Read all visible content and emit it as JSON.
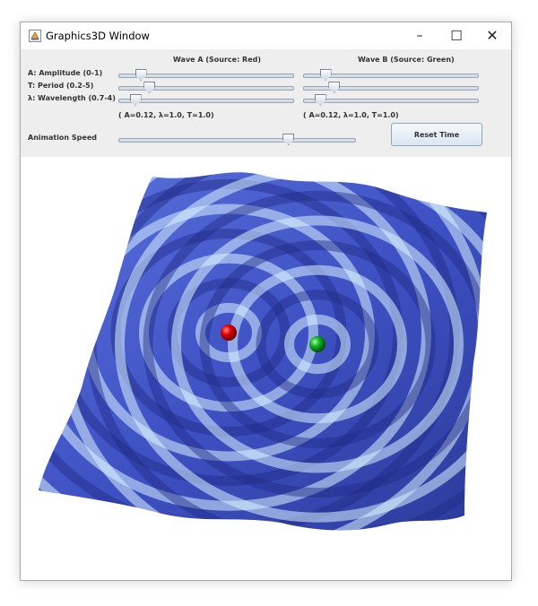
{
  "window": {
    "title": "Graphics3D Window",
    "buttons": {
      "minimize": "–",
      "maximize": "☐",
      "close": "✕"
    }
  },
  "panel": {
    "wave_a_header": "Wave A (Source: Red)",
    "wave_b_header": "Wave B (Source: Green)",
    "labels": {
      "amplitude": "A: Amplitude (0-1)",
      "period": "T: Period (0.2-5)",
      "wavelength": "λ: Wavelength (0.7-4)"
    },
    "wave_a": {
      "amplitude_level": 0.12,
      "period_level": 0.17,
      "wavelength_level": 0.09,
      "readout": "( A=0.12, λ=1.0, T=1.0)"
    },
    "wave_b": {
      "amplitude_level": 0.12,
      "period_level": 0.17,
      "wavelength_level": 0.09,
      "readout": "( A=0.12, λ=1.0, T=1.0)"
    },
    "animation_speed_label": "Animation Speed",
    "animation_speed_level": 0.71,
    "reset_label": "Reset Time"
  },
  "scene": {
    "surface_color": "#4a5fd0",
    "source_a_color": "#e00000",
    "source_b_color": "#10b020"
  }
}
